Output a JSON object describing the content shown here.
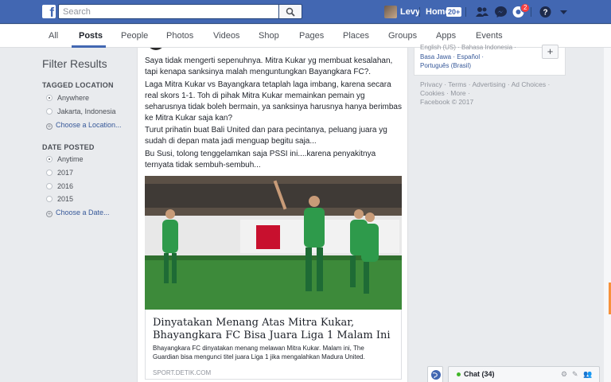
{
  "topbar": {
    "logo": "f",
    "search_placeholder": "Search",
    "user_name": "Levy",
    "home_label": "Home",
    "home_badge": "20+",
    "notification_count": "2",
    "icons": [
      "friend-requests-icon",
      "messenger-icon",
      "notifications-icon",
      "help-icon",
      "chevron-down-icon"
    ],
    "brand_color": "#4267b2"
  },
  "tabs": [
    {
      "label": "All"
    },
    {
      "label": "Posts",
      "active": true
    },
    {
      "label": "People"
    },
    {
      "label": "Photos"
    },
    {
      "label": "Videos"
    },
    {
      "label": "Shop"
    },
    {
      "label": "Pages"
    },
    {
      "label": "Places"
    },
    {
      "label": "Groups"
    },
    {
      "label": "Apps"
    },
    {
      "label": "Events"
    }
  ],
  "filters": {
    "title": "Filter Results",
    "tagged_location": {
      "heading": "TAGGED LOCATION",
      "options": [
        "Anywhere",
        "Jakarta, Indonesia"
      ],
      "selected": "Anywhere",
      "choose_label": "Choose a Location..."
    },
    "date_posted": {
      "heading": "DATE POSTED",
      "options": [
        "Anytime",
        "2017",
        "2016",
        "2015"
      ],
      "selected": "Anytime",
      "choose_label": "Choose a Date..."
    }
  },
  "post": {
    "paragraphs": [
      "Saya tidak mengerti sepenuhnya. Mitra Kukar yg membuat kesalahan, tapi kenapa sanksinya malah menguntungkan Bayangkara FC?.",
      "Laga Mitra Kukar vs Bayangkara tetaplah laga imbang, karena secara real skors 1-1. Toh di pihak Mitra Kukar memainkan pemain yg seharusnya tidak boleh bermain, ya sanksinya harusnya hanya berimbas ke Mitra Kukar saja kan?",
      "Turut prihatin buat Bali United dan para pecintanya, peluang juara yg sudah di depan mata jadi menguap begitu saja...",
      "Bu Susi, tolong tenggelamkan saja PSSI ini....karena penyakitnya ternyata tidak sembuh-sembuh..."
    ],
    "link": {
      "title": "Dinyatakan Menang Atas Mitra Kukar, Bhayangkara FC Bisa Juara Liga 1 Malam Ini",
      "description": "Bhayangkara FC dinyatakan menang melawan Mitra Kukar. Malam ini, The Guardian bisa mengunci titel juara Liga 1 jika mengalahkan Madura United.",
      "source": "SPORT.DETIK.COM"
    },
    "image_sign_text": "BNI"
  },
  "right": {
    "languages_line1": "English (US) · Bahasa Indonesia ·",
    "languages_line2": "Basa Jawa · Español ·",
    "languages_line3": "Português (Brasil)",
    "add_language_symbol": "+",
    "footer_line1": "Privacy · Terms · Advertising · Ad Choices ·",
    "footer_line2": "Cookies · More ·",
    "footer_line3": "Facebook © 2017"
  },
  "chat": {
    "label": "Chat (34)",
    "online_color": "#42b72a"
  }
}
